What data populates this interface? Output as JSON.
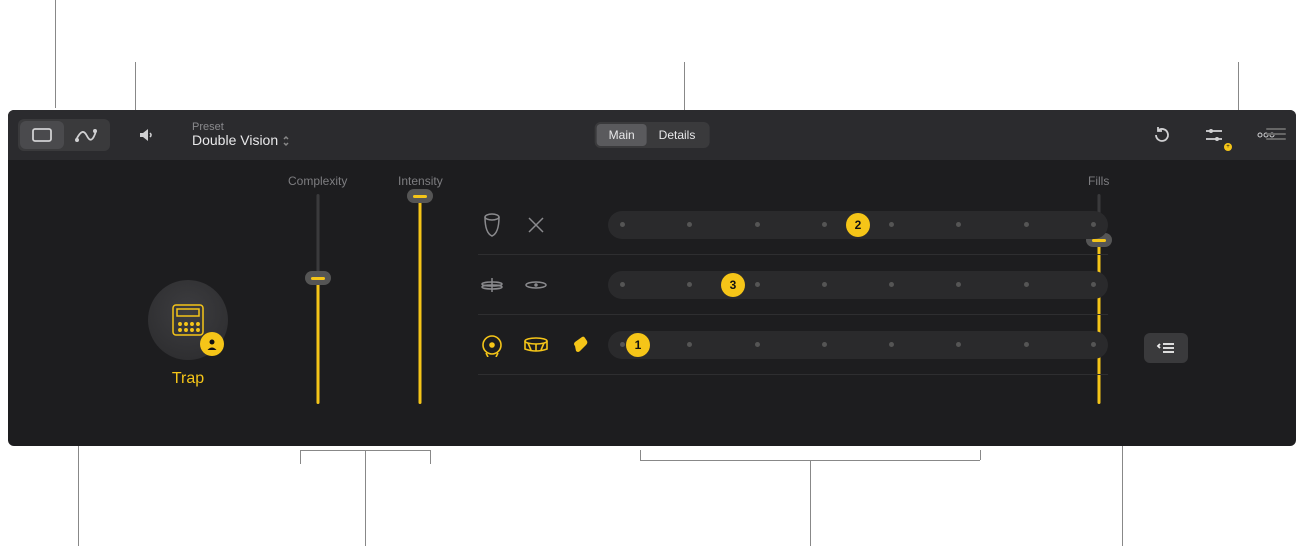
{
  "toolbar": {
    "preset_label": "Preset",
    "preset_name": "Double Vision",
    "tabs": {
      "main": "Main",
      "details": "Details"
    }
  },
  "style": {
    "name": "Trap"
  },
  "sliders": {
    "complexity": {
      "label": "Complexity",
      "value": 60
    },
    "intensity": {
      "label": "Intensity",
      "value": 99
    },
    "fills": {
      "label": "Fills",
      "value": 78
    }
  },
  "patterns": {
    "row1": {
      "position_pct": 50,
      "marker": "2"
    },
    "row2": {
      "position_pct": 25,
      "marker": "3"
    },
    "row3": {
      "position_pct": 6,
      "marker": "1"
    }
  }
}
